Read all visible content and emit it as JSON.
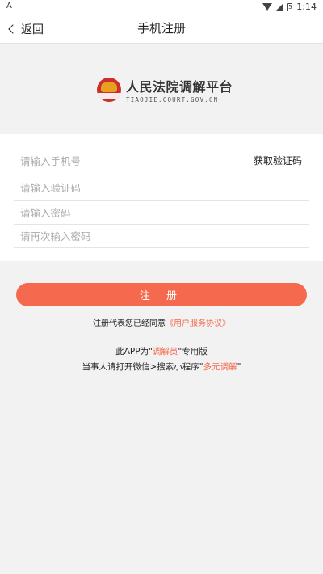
{
  "statusbar": {
    "left_icon": "A",
    "time": "1:14",
    "battery_glyph": "5"
  },
  "navbar": {
    "back_label": "返回",
    "title": "手机注册"
  },
  "logo": {
    "title": "人民法院调解平台",
    "subtitle": "TIAOJIE.COURT.GOV.CN"
  },
  "form": {
    "phone_placeholder": "请输入手机号",
    "get_code_label": "获取验证码",
    "code_placeholder": "请输入验证码",
    "password_placeholder": "请输入密码",
    "confirm_placeholder": "请再次输入密码"
  },
  "register_label": "注 册",
  "agreement": {
    "prefix": "注册代表您已经同意",
    "link": "《用户服务协议》"
  },
  "notice": {
    "line1_pre": "此APP为\"",
    "line1_hl": "调解员",
    "line1_post": "\"专用版",
    "line2_pre": "当事人请打开微信>搜索小程序\"",
    "line2_hl": "多元调解",
    "line2_post": "\""
  },
  "watermark": "",
  "colors": {
    "accent": "#f56a4e",
    "background": "#f2f2f2"
  }
}
